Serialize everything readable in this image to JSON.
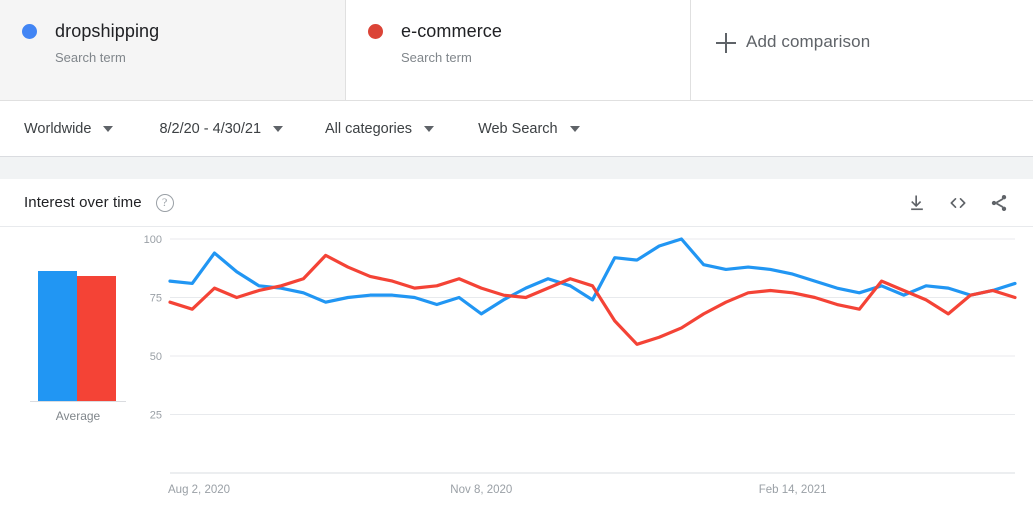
{
  "terms": [
    {
      "name": "dropshipping",
      "kind": "Search term",
      "color": "#4285f4",
      "dot_name": "legend-dot-blue"
    },
    {
      "name": "e-commerce",
      "kind": "Search term",
      "color": "#db4437",
      "dot_name": "legend-dot-red"
    }
  ],
  "add_comparison": {
    "label": "Add comparison",
    "icon": "plus-icon"
  },
  "filters": {
    "region": "Worldwide",
    "time_range": "8/2/20 - 4/30/21",
    "category": "All categories",
    "search_type": "Web Search"
  },
  "chart_header": {
    "title": "Interest over time",
    "help": "?",
    "actions": [
      {
        "name": "download-icon",
        "label": "Download"
      },
      {
        "name": "embed-code-icon",
        "label": "Embed"
      },
      {
        "name": "share-icon",
        "label": "Share"
      }
    ]
  },
  "average_panel": {
    "label": "Average",
    "values": [
      79,
      77
    ],
    "colors": [
      "#2196f3",
      "#f44336"
    ]
  },
  "chart_data": {
    "type": "line",
    "title": "Interest over time",
    "xlabel": "",
    "ylabel": "",
    "ylim": [
      0,
      100
    ],
    "yticks": [
      25,
      50,
      75,
      100
    ],
    "grid": true,
    "legend": "top",
    "xtick_labels": [
      "Aug 2, 2020",
      "Nov 8, 2020",
      "Feb 14, 2021"
    ],
    "xtick_positions": [
      0,
      14,
      28
    ],
    "x": [
      "Aug 2, 2020",
      "Aug 9, 2020",
      "Aug 16, 2020",
      "Aug 23, 2020",
      "Aug 30, 2020",
      "Sep 6, 2020",
      "Sep 13, 2020",
      "Sep 20, 2020",
      "Sep 27, 2020",
      "Oct 4, 2020",
      "Oct 11, 2020",
      "Oct 18, 2020",
      "Oct 25, 2020",
      "Nov 1, 2020",
      "Nov 8, 2020",
      "Nov 15, 2020",
      "Nov 22, 2020",
      "Nov 29, 2020",
      "Dec 6, 2020",
      "Dec 13, 2020",
      "Dec 20, 2020",
      "Dec 27, 2020",
      "Jan 3, 2021",
      "Jan 10, 2021",
      "Jan 17, 2021",
      "Jan 24, 2021",
      "Jan 31, 2021",
      "Feb 7, 2021",
      "Feb 14, 2021",
      "Feb 21, 2021",
      "Feb 28, 2021",
      "Mar 7, 2021",
      "Mar 14, 2021",
      "Mar 21, 2021",
      "Mar 28, 2021",
      "Apr 4, 2021",
      "Apr 11, 2021",
      "Apr 18, 2021",
      "Apr 25, 2021"
    ],
    "series": [
      {
        "name": "dropshipping",
        "color": "#2196f3",
        "values": [
          82,
          81,
          94,
          86,
          80,
          79,
          77,
          73,
          75,
          76,
          76,
          75,
          72,
          75,
          68,
          74,
          79,
          83,
          80,
          74,
          92,
          91,
          97,
          100,
          89,
          87,
          88,
          87,
          85,
          82,
          79,
          77,
          80,
          76,
          80,
          79,
          76,
          78,
          81
        ]
      },
      {
        "name": "e-commerce",
        "color": "#f44336",
        "values": [
          73,
          70,
          79,
          75,
          78,
          80,
          83,
          93,
          88,
          84,
          82,
          79,
          80,
          83,
          79,
          76,
          75,
          79,
          83,
          80,
          65,
          55,
          58,
          62,
          68,
          73,
          77,
          78,
          77,
          75,
          72,
          70,
          82,
          78,
          74,
          68,
          76,
          78,
          75
        ]
      }
    ]
  }
}
